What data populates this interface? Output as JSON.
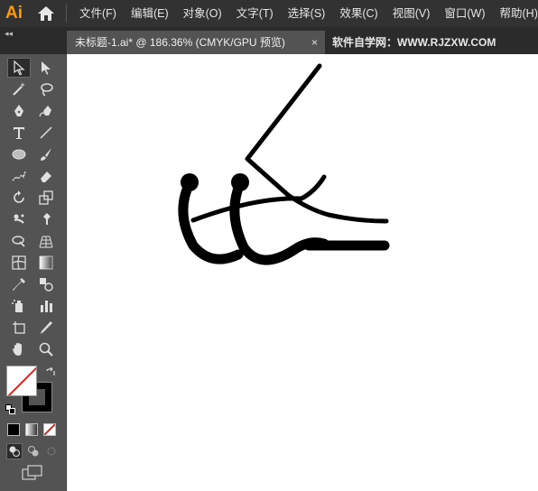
{
  "app": {
    "logo": "Ai"
  },
  "menu": {
    "items": [
      "文件(F)",
      "编辑(E)",
      "对象(O)",
      "文字(T)",
      "选择(S)",
      "效果(C)",
      "视图(V)",
      "窗口(W)",
      "帮助(H)"
    ]
  },
  "document_tab": {
    "title": "未标题-1.ai* @ 186.36% (CMYK/GPU 预览)",
    "close": "×"
  },
  "watermark_tab": {
    "text": "软件自学网：WWW.RJZXW.COM"
  },
  "toolbar": {
    "collapse_glyph": "◂◂",
    "tools": [
      "selection-tool",
      "direct-selection-tool",
      "magic-wand-tool",
      "lasso-tool",
      "pen-tool",
      "curvature-tool",
      "type-tool",
      "line-segment-tool",
      "ellipse-tool",
      "paintbrush-tool",
      "shaper-tool",
      "eraser-tool",
      "rotate-tool",
      "scale-tool",
      "puppet-warp-tool",
      "free-transform-tool",
      "shape-builder-tool",
      "perspective-grid-tool",
      "mesh-tool",
      "gradient-tool",
      "eyedropper-tool",
      "blend-tool",
      "symbol-sprayer-tool",
      "column-graph-tool",
      "artboard-tool",
      "slice-tool",
      "hand-tool",
      "zoom-tool"
    ],
    "fill_color": "#ffffff",
    "stroke_color": "#000000",
    "accent_none": "#d9261c"
  }
}
